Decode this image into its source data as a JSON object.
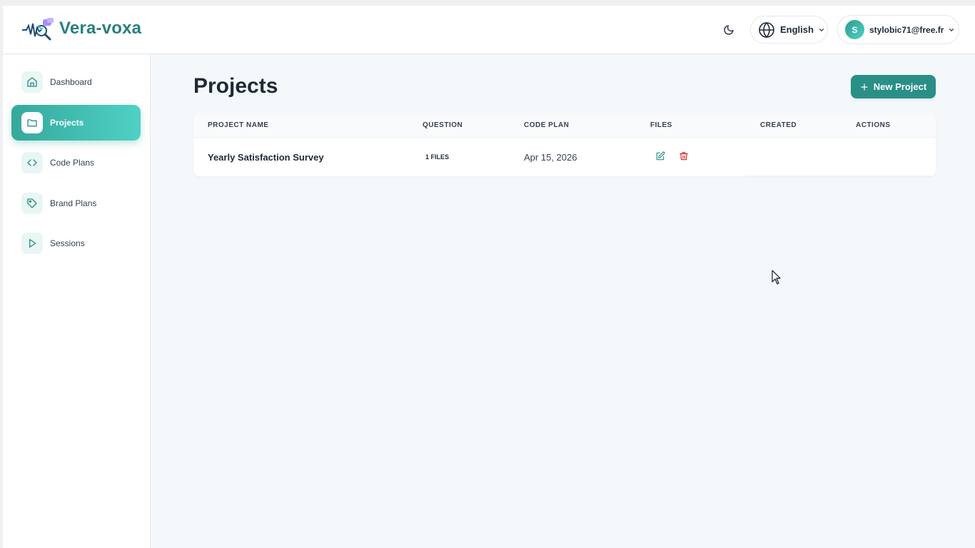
{
  "app": {
    "brand": "Vera-voxa",
    "logo_icon": "soundwave-magnifier-logo"
  },
  "header": {
    "theme_icon": "moon-icon",
    "language": {
      "label": "English",
      "icon": "globe-icon"
    },
    "user": {
      "initial": "S",
      "email": "stylobic71@free.fr"
    }
  },
  "sidebar": {
    "items": [
      {
        "label": "Dashboard",
        "icon": "home-icon",
        "active": false
      },
      {
        "label": "Projects",
        "icon": "folder-icon",
        "active": true
      },
      {
        "label": "Code Plans",
        "icon": "code-icon",
        "active": false
      },
      {
        "label": "Brand Plans",
        "icon": "tag-icon",
        "active": false
      },
      {
        "label": "Sessions",
        "icon": "play-icon",
        "active": false
      }
    ]
  },
  "main": {
    "title": "Projects",
    "new_button": "New Project",
    "table": {
      "columns": [
        "PROJECT NAME",
        "QUESTION",
        "CODE PLAN",
        "FILES",
        "CREATED",
        "ACTIONS"
      ],
      "rows": [
        {
          "name": "Yearly Satisfaction Survey",
          "files": "1 FILES",
          "date": "Apr 15, 2026"
        }
      ]
    }
  },
  "colors": {
    "accent": "#2a8f87",
    "brand": "#2a7f80",
    "danger": "#dc2626",
    "background": "#f5f8fb"
  }
}
